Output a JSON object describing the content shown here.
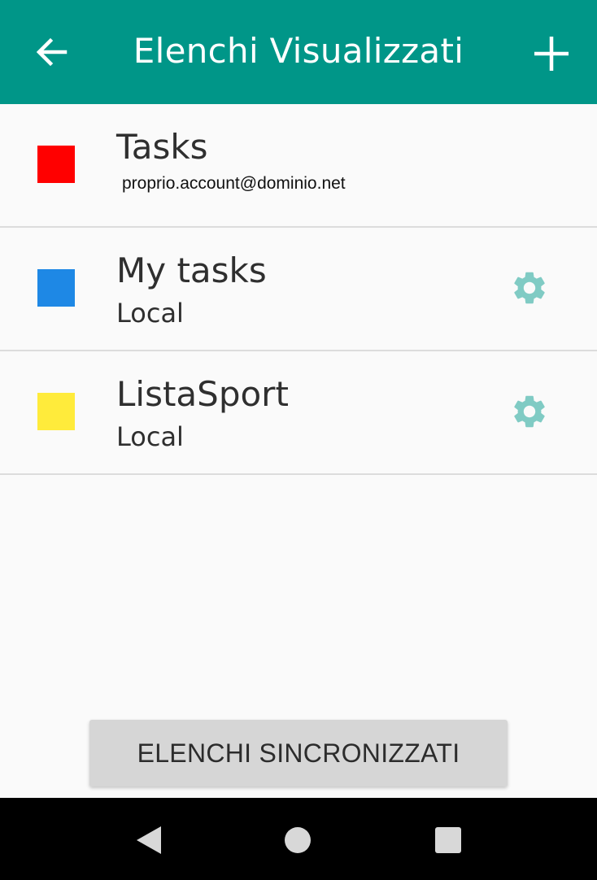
{
  "appbar": {
    "title": "Elenchi Visualizzati",
    "back_icon": "arrow-left-icon",
    "add_icon": "plus-icon",
    "color": "#009688"
  },
  "lists": [
    {
      "name": "Tasks",
      "subtitle": "proprio.account@dominio.net",
      "color": "#ff0000",
      "has_settings": false
    },
    {
      "name": "My tasks",
      "subtitle": "Local",
      "color": "#1e88e5",
      "has_settings": true
    },
    {
      "name": "ListaSport",
      "subtitle": "Local",
      "color": "#ffeb3b",
      "has_settings": true
    }
  ],
  "settings_icon": "gear-icon",
  "settings_icon_color": "#80cbc4",
  "sync_button": {
    "label": "ELENCHI SINCRONIZZATI"
  },
  "navbar": {
    "back_icon": "triangle-back-icon",
    "home_icon": "circle-home-icon",
    "recents_icon": "square-recents-icon"
  }
}
